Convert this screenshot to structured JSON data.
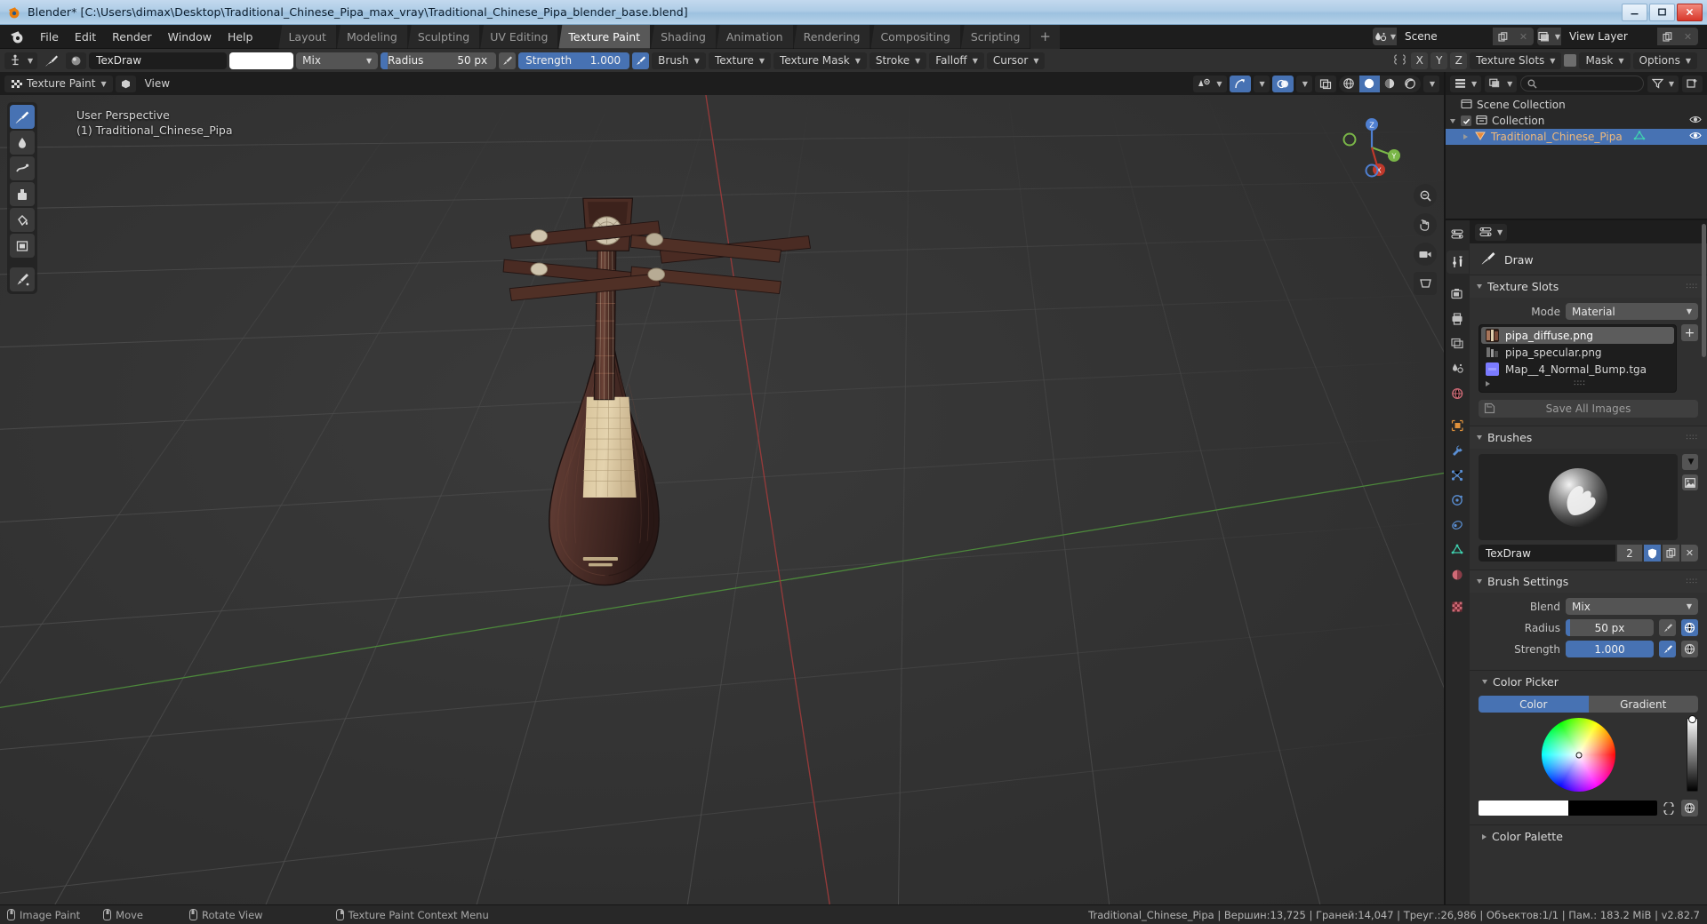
{
  "window": {
    "title": "Blender* [C:\\Users\\dimax\\Desktop\\Traditional_Chinese_Pipa_max_vray\\Traditional_Chinese_Pipa_blender_base.blend]",
    "minimize_label": "–",
    "maximize_label": "❐",
    "close_label": "✕"
  },
  "topbar": {
    "menus": [
      "File",
      "Edit",
      "Render",
      "Window",
      "Help"
    ],
    "workspaces": [
      {
        "label": "Layout",
        "active": false
      },
      {
        "label": "Modeling",
        "active": false
      },
      {
        "label": "Sculpting",
        "active": false
      },
      {
        "label": "UV Editing",
        "active": false
      },
      {
        "label": "Texture Paint",
        "active": true
      },
      {
        "label": "Shading",
        "active": false
      },
      {
        "label": "Animation",
        "active": false
      },
      {
        "label": "Rendering",
        "active": false
      },
      {
        "label": "Compositing",
        "active": false
      },
      {
        "label": "Scripting",
        "active": false
      }
    ],
    "add_workspace_label": "+",
    "scene_name": "Scene",
    "view_layer_name": "View Layer"
  },
  "tool_settings": {
    "brush_name": "TexDraw",
    "blend_mode": "Mix",
    "radius_label": "Radius",
    "radius_value": "50 px",
    "strength_label": "Strength",
    "strength_value": "1.000",
    "menus": [
      "Brush",
      "Texture",
      "Texture Mask",
      "Stroke",
      "Falloff",
      "Cursor"
    ],
    "symmetry_axes": [
      "X",
      "Y",
      "Z"
    ],
    "texture_slots_label": "Texture Slots",
    "mask_label": "Mask",
    "options_label": "Options"
  },
  "viewport": {
    "mode": "Texture Paint",
    "view_menu": "View",
    "perspective_label": "User Perspective",
    "object_label": "(1) Traditional_Chinese_Pipa",
    "gizmo_axes": {
      "x": "X",
      "y": "Y",
      "z": "Z"
    }
  },
  "outliner": {
    "search_placeholder": "",
    "rows": [
      {
        "label": "Scene Collection",
        "indent": 0,
        "selected": false,
        "icon": "scene-collection-icon",
        "has_eye": false,
        "has_check": false,
        "expander": "none"
      },
      {
        "label": "Collection",
        "indent": 1,
        "selected": false,
        "icon": "collection-icon",
        "has_eye": true,
        "has_check": true,
        "expander": "down"
      },
      {
        "label": "Traditional_Chinese_Pipa",
        "indent": 2,
        "selected": true,
        "icon": "object-icon",
        "has_eye": true,
        "has_check": false,
        "expander": "right"
      }
    ]
  },
  "properties": {
    "brush_header": "Draw",
    "panels": {
      "texture_slots": {
        "title": "Texture Slots",
        "mode_label": "Mode",
        "mode_value": "Material",
        "slots": [
          {
            "name": "pipa_diffuse.png",
            "selected": true
          },
          {
            "name": "pipa_specular.png",
            "selected": false
          },
          {
            "name": "Map__4_Normal_Bump.tga",
            "selected": false
          }
        ],
        "add_label": "+",
        "save_all_label": "Save All Images"
      },
      "brushes": {
        "title": "Brushes",
        "brush_name": "TexDraw",
        "users_count": "2",
        "fake_user_on": true
      },
      "brush_settings": {
        "title": "Brush Settings",
        "blend_label": "Blend",
        "blend_value": "Mix",
        "radius_label": "Radius",
        "radius_value": "50 px",
        "radius_fill_pct": 5,
        "strength_label": "Strength",
        "strength_value": "1.000",
        "strength_fill_pct": 100
      },
      "color_picker": {
        "title": "Color Picker",
        "tab_color": "Color",
        "tab_gradient": "Gradient",
        "active_tab": "Color",
        "primary_color": "#ffffff",
        "secondary_color": "#000000"
      },
      "color_palette": {
        "title": "Color Palette"
      }
    }
  },
  "statusbar": {
    "hints": [
      {
        "label": "Image Paint",
        "mouse": "left"
      },
      {
        "label": "Move",
        "mouse": "middle"
      },
      {
        "label": "Rotate View",
        "mouse": "middle"
      },
      {
        "label": "Texture Paint Context Menu",
        "mouse": "right"
      }
    ],
    "stats": "Traditional_Chinese_Pipa | Вершин:13,725 | Граней:14,047 | Треуг.:26,986 | Объектов:1/1 | Пам.: 183.2 MiB | v2.82.7"
  },
  "colors": {
    "accent": "#4772b3",
    "panel": "#303030",
    "header": "#1d1d1d",
    "widget": "#545454"
  }
}
